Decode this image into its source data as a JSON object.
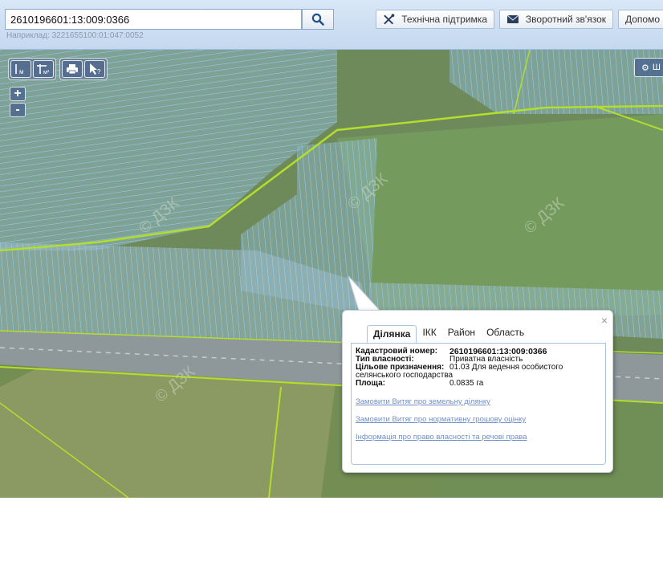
{
  "header": {
    "search_value": "2610196601:13:009:0366",
    "search_hint": "Наприклад: 3221655100:01:047:0052",
    "buttons": [
      {
        "label": "Технічна підтримка",
        "icon": "wrench-screwdriver-icon"
      },
      {
        "label": "Зворотний зв'язок",
        "icon": "envelope-icon"
      },
      {
        "label": "Допомо",
        "icon": ""
      }
    ]
  },
  "map": {
    "tools": {
      "distance_label": "м",
      "area_label": "м²",
      "identify_label": "?"
    },
    "zoom_in": "+",
    "zoom_out": "-",
    "layers_label": "Ш",
    "watermark": "© ДЗК"
  },
  "popup": {
    "close_label": "×",
    "tabs": [
      "Ділянка",
      "ІКК",
      "Район",
      "Область"
    ],
    "active_tab": 0,
    "fields": [
      {
        "label": "Кадастровий номер:",
        "value": "2610196601:13:009:0366"
      },
      {
        "label": "Тип власності:",
        "value": "Приватна власність"
      },
      {
        "label": "Цільове призначення:",
        "value": "01.03 Для ведення особистого"
      },
      {
        "label": "",
        "value": "селянського господарства"
      },
      {
        "label": "Площа:",
        "value": "0.0835 га"
      }
    ],
    "links": [
      "Замовити Витяг про земельну ділянку",
      "Замовити Витяг про нормативну грошову оцінку",
      "Інформація про право власності та речові права"
    ]
  },
  "colors": {
    "parcel_outline": "#7fc8f0",
    "boundary_line": "#b4de2c",
    "header_bg": "#c4d8ef",
    "link": "#6f8fc7"
  }
}
